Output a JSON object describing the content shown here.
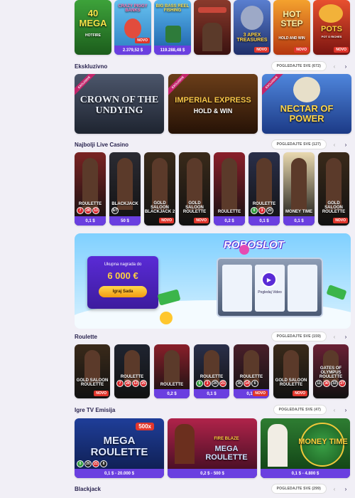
{
  "top_games": [
    {
      "title": "40 MEGA",
      "sub": "HOTFIRE",
      "badge": "",
      "price": "",
      "bg": "#2f8a2a"
    },
    {
      "title": "CRAZY PIGGY BANKS",
      "sub": "",
      "badge": "NOVO",
      "price": "2.379,52 $",
      "bg": "#49a3d8"
    },
    {
      "title": "BIG BASS REEL FISHING",
      "sub": "",
      "badge": "",
      "price": "119.288,48 $",
      "bg": "#1e7fc9"
    },
    {
      "title": "",
      "sub": "",
      "badge": "",
      "price": "",
      "bg": "#7a2d25"
    },
    {
      "title": "3 APEX TREASURES",
      "sub": "",
      "badge": "NOVO",
      "price": "",
      "bg": "#304b9a"
    },
    {
      "title": "HOT STEP",
      "sub": "HOLD AND WIN",
      "badge": "NOVO",
      "price": "",
      "bg": "#e77b1f"
    },
    {
      "title": "POTS",
      "sub": "POT O RICHES",
      "badge": "NOVO",
      "price": "",
      "bg": "#c42520"
    }
  ],
  "sections": {
    "exclusive": {
      "title": "Ekskluzivno",
      "see_all": "POGLEDAJTE SVE (672)"
    },
    "live": {
      "title": "Najbolji Live Casino",
      "see_all": "POGLEDAJTE SVE (127)"
    },
    "roulette": {
      "title": "Roulette",
      "see_all": "POGLEDAJTE SVE (159)"
    },
    "tv": {
      "title": "Igre TV Emisija",
      "see_all": "POGLEDAJTE SVE (47)"
    },
    "blackjack": {
      "title": "Blackjack",
      "see_all": "POGLEDAJTE SVE (299)"
    }
  },
  "exclusive_games": [
    {
      "title": "CROWN OF THE UNDYING",
      "ribbon": "EXCLUSIVE",
      "bg": "#3b4457"
    },
    {
      "title": "IMPERIAL EXPRESS",
      "sub": "HOLD & WIN",
      "ribbon": "EXCLUSIVE",
      "bg": "#4a2b14"
    },
    {
      "title": "NECTAR OF POWER",
      "ribbon": "EXCLUSIVE",
      "bg": "#2d5fb8"
    }
  ],
  "live_games": [
    {
      "label": "ROULETTE",
      "nums": [
        "7",
        "28",
        "13"
      ],
      "price": "0,1 $",
      "badge": ""
    },
    {
      "label": "BLACKJACK",
      "nums": [
        "6/7"
      ],
      "price": "50 $",
      "badge": ""
    },
    {
      "label": "GOLD SALOON BLACKJACK 2",
      "nums": [],
      "price": "",
      "badge": "NOVO"
    },
    {
      "label": "GOLD SALOON ROULETTE",
      "nums": [],
      "price": "",
      "badge": "NOVO"
    },
    {
      "label": "ROULETTE",
      "nums": [],
      "price": "0,2 $",
      "badge": ""
    },
    {
      "label": "ROULETTE",
      "nums": [
        "0",
        "3",
        "20"
      ],
      "price": "0,1 $",
      "badge": ""
    },
    {
      "label": "MONEY TIME",
      "nums": [],
      "price": "0,1 $",
      "badge": ""
    },
    {
      "label": "GOLD SALOON ROULETTE",
      "nums": [],
      "price": "",
      "badge": "NOVO"
    }
  ],
  "banner": {
    "prize_label": "Ukupna nagrada do",
    "prize_value": "6 000 €",
    "cta": "Igraj Sada",
    "logo": "ROBOSLOT",
    "video": "Pogledaj Video"
  },
  "roulette_games": [
    {
      "label": "GOLD SALOON ROULETTE",
      "nums": [],
      "price": "",
      "badge": "NOVO"
    },
    {
      "label": "ROULETTE",
      "nums": [
        "7",
        "28",
        "13",
        "25"
      ],
      "price": "",
      "badge": ""
    },
    {
      "label": "ROULETTE",
      "nums": [],
      "price": "0,2 $",
      "badge": ""
    },
    {
      "label": "ROULETTE",
      "nums": [
        "0",
        "3",
        "20",
        "21"
      ],
      "price": "0,1 $",
      "badge": ""
    },
    {
      "label": "ROULETTE",
      "nums": [
        "35",
        "14",
        "6"
      ],
      "price": "0,1 $",
      "badge": "NOVO"
    },
    {
      "label": "GOLD SALOON ROULETTE",
      "nums": [],
      "price": "",
      "badge": "NOVO"
    },
    {
      "label": "GATES OF OLYMPUS ROULETTE",
      "nums": [
        "11",
        "30",
        "33",
        "27"
      ],
      "price": "",
      "badge": ""
    }
  ],
  "tv_games": [
    {
      "title": "MEGA ROULETTE",
      "extra": "500x",
      "price": "0,1 $ - 20.000 $",
      "nums": [
        "0",
        "20",
        "21",
        "8"
      ]
    },
    {
      "title": "MEGA ROULETTE",
      "extra": "FIRE BLAZE",
      "price": "0,2 $ - 500 $",
      "nums": []
    },
    {
      "title": "MONEY TIME",
      "extra": "",
      "price": "0,1 $ - 4.800 $",
      "nums": []
    }
  ]
}
